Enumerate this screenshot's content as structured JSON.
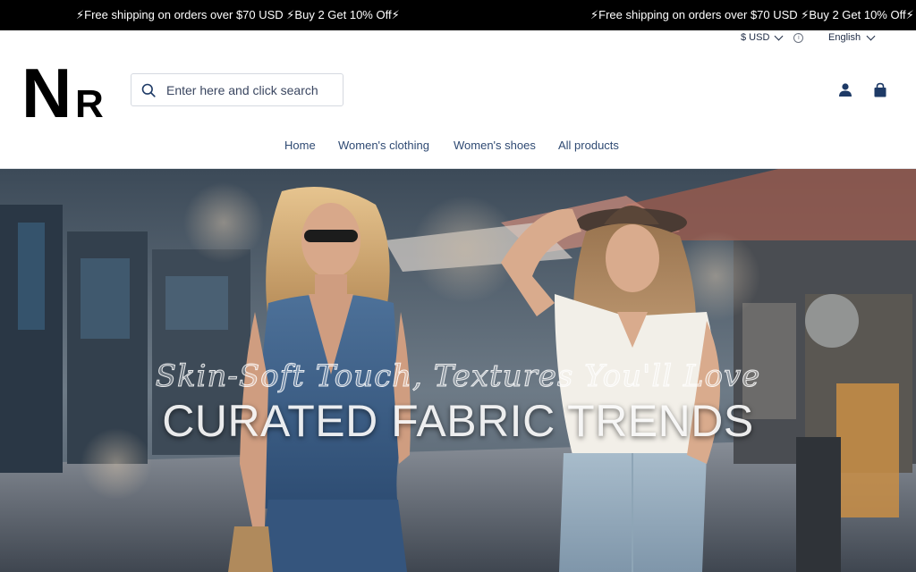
{
  "announcement": {
    "messages": [
      "⚡Free shipping on orders over $70 USD ⚡Buy 2 Get 10% Off⚡",
      "⚡Free shipping on orders over $70 USD ⚡Buy 2 Get 10% Off⚡"
    ]
  },
  "utility": {
    "currency": "$ USD",
    "language": "English"
  },
  "header": {
    "logo_text_big": "N",
    "logo_text_small": "R",
    "search_placeholder": "Enter here and click search",
    "icons": [
      "search-icon",
      "account-icon",
      "cart-icon"
    ]
  },
  "nav": {
    "items": [
      "Home",
      "Women's clothing",
      "Women's shoes",
      "All products"
    ]
  },
  "hero": {
    "script_text": "Skin-Soft Touch, Textures You'll Love",
    "headline": "CURATED FABRIC TRENDS"
  },
  "colors": {
    "announcement_bg": "#000000",
    "nav_text": "#2f4a73",
    "icon_accent": "#1e3a66"
  }
}
